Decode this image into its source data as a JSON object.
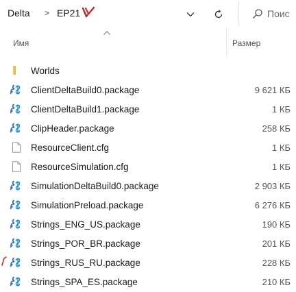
{
  "breadcrumb": {
    "items": [
      "Delta",
      "EP21"
    ],
    "separator": ">"
  },
  "toolbar": {
    "dropdown_icon": "chevron-down-icon",
    "refresh_icon": "refresh-icon"
  },
  "search": {
    "placeholder": "Поис",
    "icon": "search-icon"
  },
  "columns": {
    "name": "Имя",
    "size": "Размер"
  },
  "files": [
    {
      "name": "Worlds",
      "size": "",
      "icon": "folder-icon",
      "type": "folder"
    },
    {
      "name": "ClientDeltaBuild0.package",
      "size": "9 621 КБ",
      "icon": "package-icon",
      "type": "package"
    },
    {
      "name": "ClientDeltaBuild1.package",
      "size": "1 КБ",
      "icon": "package-icon",
      "type": "package"
    },
    {
      "name": "ClipHeader.package",
      "size": "258 КБ",
      "icon": "package-icon",
      "type": "package"
    },
    {
      "name": "ResourceClient.cfg",
      "size": "1 КБ",
      "icon": "file-icon",
      "type": "file"
    },
    {
      "name": "ResourceSimulation.cfg",
      "size": "1 КБ",
      "icon": "file-icon",
      "type": "file"
    },
    {
      "name": "SimulationDeltaBuild0.package",
      "size": "2 903 КБ",
      "icon": "package-icon",
      "type": "package"
    },
    {
      "name": "SimulationPreload.package",
      "size": "6 276 КБ",
      "icon": "package-icon",
      "type": "package"
    },
    {
      "name": "Strings_ENG_US.package",
      "size": "190 КБ",
      "icon": "package-icon",
      "type": "package"
    },
    {
      "name": "Strings_POR_BR.package",
      "size": "201 КБ",
      "icon": "package-icon",
      "type": "package"
    },
    {
      "name": "Strings_RUS_RU.package",
      "size": "228 КБ",
      "icon": "package-icon",
      "type": "package"
    },
    {
      "name": "Strings_SPA_ES.package",
      "size": "210 КБ",
      "icon": "package-icon",
      "type": "package"
    }
  ],
  "colors": {
    "annotation_red": "#c0282d",
    "folder_yellow": "#f2c94c",
    "package_blue": "#2f6fd6",
    "package_accent": "#1e8fd6"
  }
}
